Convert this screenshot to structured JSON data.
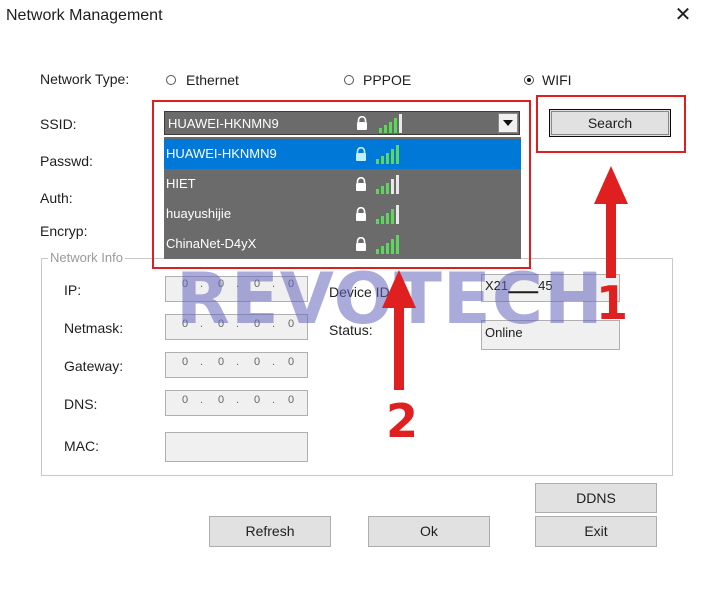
{
  "window": {
    "title": "Network Management"
  },
  "network_type": {
    "label": "Network Type:",
    "options": [
      {
        "label": "Ethernet",
        "selected": false
      },
      {
        "label": "PPPOE",
        "selected": false
      },
      {
        "label": "WIFI",
        "selected": true
      }
    ]
  },
  "ssid": {
    "label": "SSID:",
    "value": "HUAWEI-HKNMN9",
    "options": [
      {
        "label": "HUAWEI-HKNMN9",
        "selected": true,
        "signal_bars": 5
      },
      {
        "label": "HIET",
        "selected": false,
        "signal_bars": 3
      },
      {
        "label": "huayushijie",
        "selected": false,
        "signal_bars": 4
      },
      {
        "label": "ChinaNet-D4yX",
        "selected": false,
        "signal_bars": 5
      }
    ]
  },
  "labels": {
    "passwd": "Passwd:",
    "auth": "Auth:",
    "encryp": "Encryp:"
  },
  "network_info": {
    "legend": "Network Info",
    "ip_label": "IP:",
    "netmask_label": "Netmask:",
    "gateway_label": "Gateway:",
    "dns_label": "DNS:",
    "mac_label": "MAC:",
    "octets": {
      "ip": [
        "0",
        "0",
        "0",
        "0"
      ],
      "netmask": [
        "0",
        "0",
        "0",
        "0"
      ],
      "gateway": [
        "0",
        "0",
        "0",
        "0"
      ],
      "dns": [
        "0",
        "0",
        "0",
        "0"
      ]
    },
    "device_id_label": "Device ID:",
    "device_id_value": "X21▁▁▁45",
    "status_label": "Status:",
    "status_value": "Online"
  },
  "buttons": {
    "search": "Search",
    "ddns": "DDNS",
    "refresh": "Refresh",
    "ok": "Ok",
    "exit": "Exit"
  },
  "annotations": {
    "watermark": "REVOTECH",
    "arrow_1": "1",
    "arrow_2": "2"
  },
  "colors": {
    "highlight": "#e01e1e",
    "selection": "#0078d7",
    "signal_green": "#5cd65c"
  },
  "icons": {
    "close": "close-icon",
    "lock": "lock-icon",
    "signal": "wifi-signal-icon",
    "dropdown": "chevron-down-icon"
  }
}
